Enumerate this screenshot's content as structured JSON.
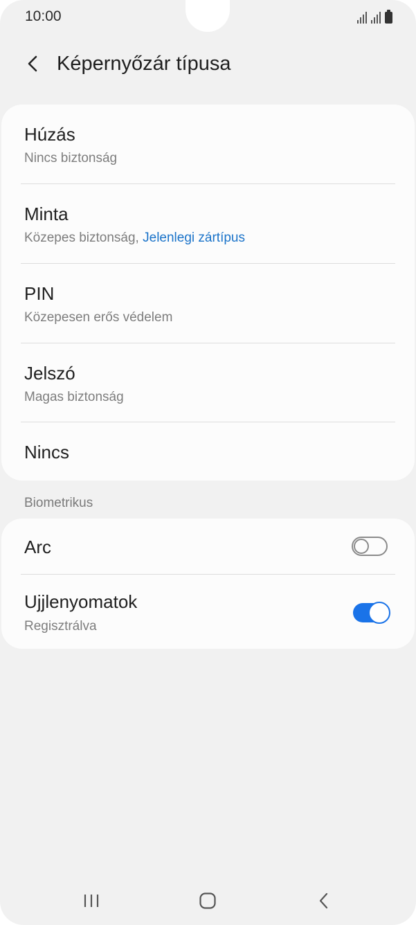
{
  "status_bar": {
    "time": "10:00"
  },
  "header": {
    "title": "Képernyőzár típusa"
  },
  "lock_types": [
    {
      "title": "Húzás",
      "subtitle": "Nincs biztonság",
      "subtitle_highlight": ""
    },
    {
      "title": "Minta",
      "subtitle": "Közepes biztonság, ",
      "subtitle_highlight": "Jelenlegi zártípus"
    },
    {
      "title": "PIN",
      "subtitle": "Közepesen erős védelem",
      "subtitle_highlight": ""
    },
    {
      "title": "Jelszó",
      "subtitle": "Magas biztonság",
      "subtitle_highlight": ""
    },
    {
      "title": "Nincs",
      "subtitle": "",
      "subtitle_highlight": ""
    }
  ],
  "biometrics": {
    "section_label": "Biometrikus",
    "items": [
      {
        "title": "Arc",
        "subtitle": "",
        "enabled": false
      },
      {
        "title": "Ujjlenyomatok",
        "subtitle": "Regisztrálva",
        "enabled": true
      }
    ]
  },
  "icons": {
    "back": "chevron-left-icon",
    "nav_recents": "recents-icon",
    "nav_home": "home-icon",
    "nav_back": "back-icon"
  },
  "colors": {
    "accent": "#1a73e8",
    "link": "#1a73c9",
    "background": "#f1f1f1",
    "card": "#fcfcfc"
  }
}
